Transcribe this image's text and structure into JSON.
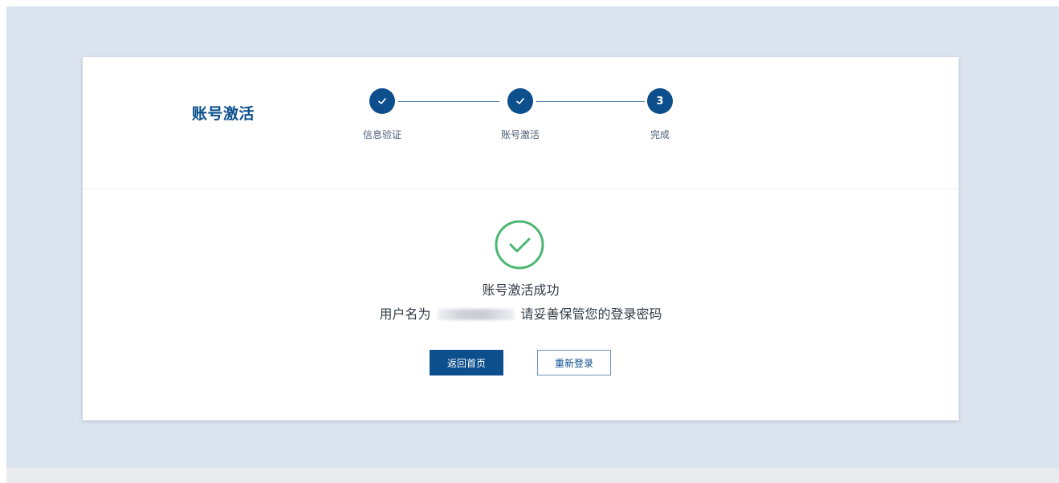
{
  "colors": {
    "accent": "#0d4e8d",
    "success": "#4cb673",
    "background": "#dbe3ef"
  },
  "header": {
    "title": "账号激活"
  },
  "steps": [
    {
      "label": "信息验证",
      "status": "done",
      "icon": "check-icon"
    },
    {
      "label": "账号激活",
      "status": "done",
      "icon": "check-icon"
    },
    {
      "label": "完成",
      "status": "current",
      "number": "3"
    }
  ],
  "result": {
    "icon": "success-check-circle-icon",
    "title": "账号激活成功",
    "username_prefix": "用户名为",
    "username_suffix": "请妥善保管您的登录密码"
  },
  "actions": {
    "primary_label": "返回首页",
    "secondary_label": "重新登录"
  }
}
